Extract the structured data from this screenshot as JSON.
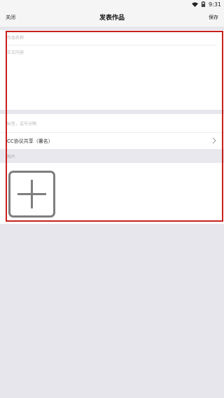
{
  "status_bar": {
    "time": "9:31",
    "icons": [
      "wifi-icon",
      "battery-icon"
    ]
  },
  "nav": {
    "close_label": "关闭",
    "title": "发表作品",
    "save_label": "保存"
  },
  "form": {
    "title_placeholder": "作品名称",
    "body_placeholder": "正文内容",
    "tags_placeholder": "标签，逗号分隔",
    "license_label": "CC协议共享（署名）",
    "images_label": "图片"
  },
  "colors": {
    "highlight": "#c8201c",
    "background": "#e6e6ec",
    "placeholder": "#b8b8b8"
  }
}
